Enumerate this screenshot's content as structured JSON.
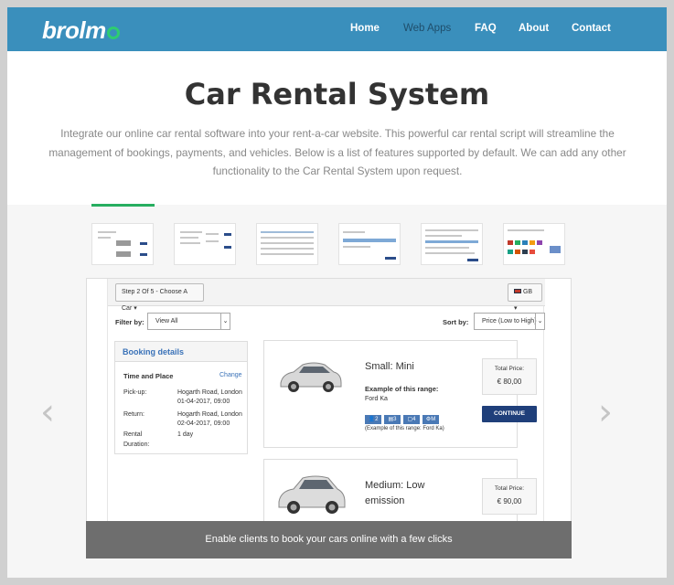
{
  "header": {
    "logo_text": "brolm",
    "nav": [
      {
        "label": "Home",
        "active": false
      },
      {
        "label": "Web Apps",
        "active": true
      },
      {
        "label": "FAQ",
        "active": false
      },
      {
        "label": "About",
        "active": false
      },
      {
        "label": "Contact",
        "active": false
      }
    ]
  },
  "hero": {
    "title": "Car Rental System",
    "intro": "Integrate our online car rental software into your rent-a-car website. This powerful car rental script will streamline the management of bookings, payments, and vehicles. Below is a list of features supported by default. We can add any other functionality to the Car Rental System upon request."
  },
  "gallery": {
    "prev_arrow": "‹",
    "next_arrow": "›",
    "caption": "Enable clients to book your cars online with a few clicks"
  },
  "app": {
    "step_label": "Step 2 Of 5 - Choose A Car",
    "language": "GB",
    "filter_label": "Filter by:",
    "filter_value": "View All",
    "sort_label": "Sort by:",
    "sort_value": "Price (Low to High)",
    "booking": {
      "title": "Booking details",
      "section": "Time and Place",
      "change": "Change",
      "pickup_label": "Pick-up:",
      "pickup_place": "Hogarth Road, London",
      "pickup_time": "01-04-2017, 09:00",
      "return_label": "Return:",
      "return_place": "Hogarth Road, London",
      "return_time": "02-04-2017, 09:00",
      "duration_label_1": "Rental",
      "duration_label_2": "Duration:",
      "duration_value": "1 day"
    },
    "cars": [
      {
        "name": "Small: Mini",
        "example_label": "Example of this range:",
        "example_model": "Ford Ka",
        "features": [
          "2",
          "3",
          "4",
          "M"
        ],
        "features_note": "(Example of this range: Ford Ka)",
        "price_label": "Total Price:",
        "price": "€ 80,00",
        "button": "CONTINUE"
      },
      {
        "name_line1": "Medium: Low",
        "name_line2": "emission",
        "price_label": "Total Price:",
        "price": "€ 90,00"
      }
    ]
  },
  "colors": {
    "header_bg": "#3a8fbc",
    "accent_green": "#27ae60",
    "button_blue": "#1f3f7a"
  }
}
